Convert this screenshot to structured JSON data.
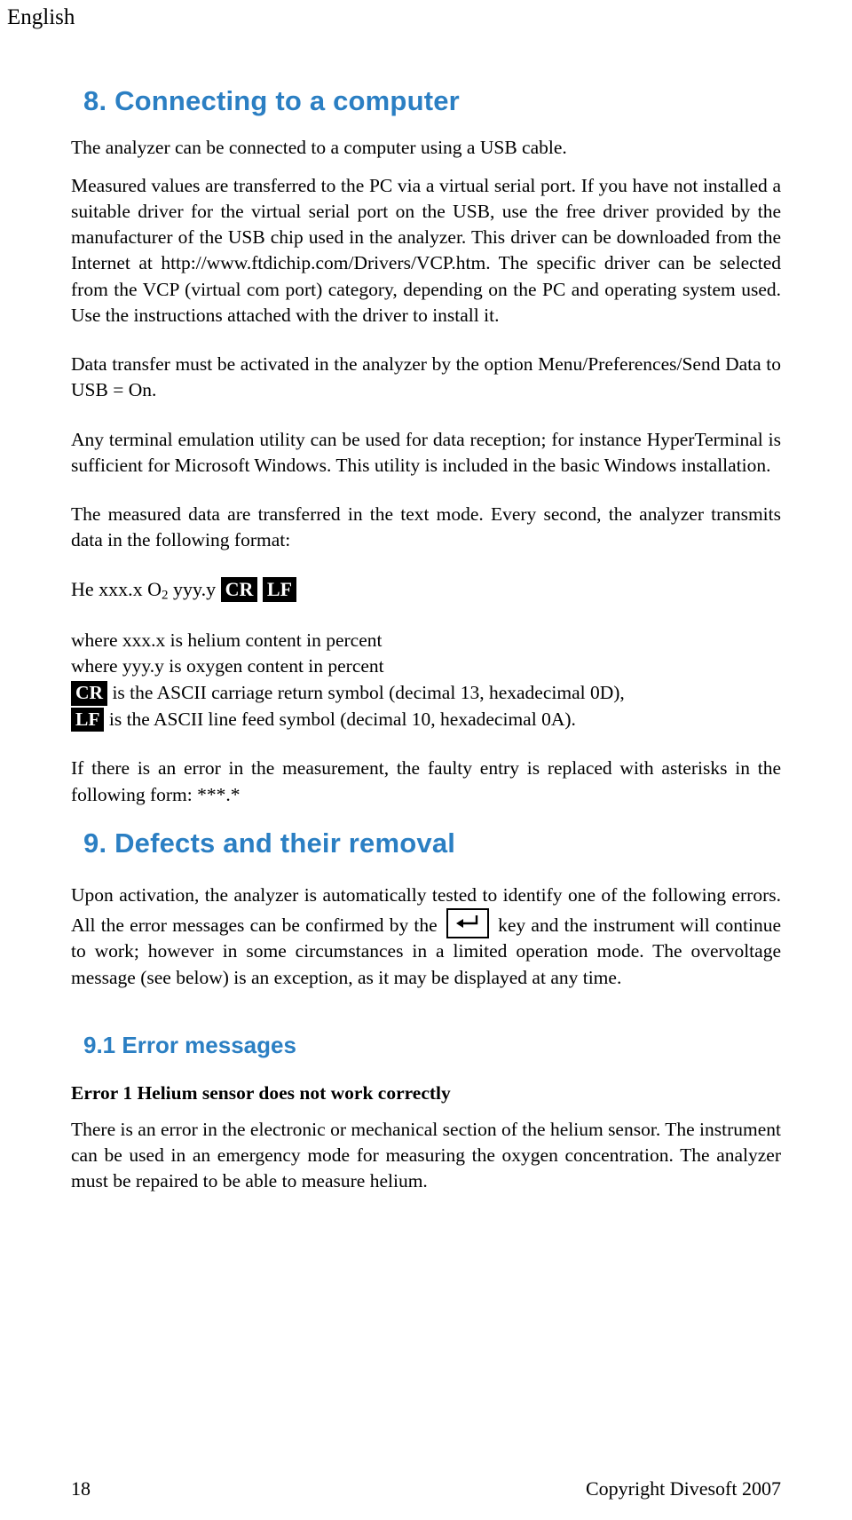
{
  "header": {
    "language": "English"
  },
  "sections": [
    {
      "number_title": "8. Connecting to a computer",
      "paragraphs": [
        "The analyzer can be connected to a computer using a USB cable.",
        "Measured values are transferred to the PC via a virtual serial port. If you have not installed a suitable driver for the virtual serial port on the USB, use the free driver provided by the manufacturer of the USB chip used in the analyzer. This driver can be downloaded from the Internet at http://www.ftdichip.com/Drivers/VCP.htm. The specific driver can be selected from the VCP (virtual com port) category, depending on the PC and operating system used. Use the instructions attached with the driver to install it.",
        "Data transfer must be activated in the analyzer by the option Menu/Preferences/Send Data to USB = On.",
        "Any terminal emulation utility can be used for data reception; for instance HyperTerminal is sufficient for Microsoft Windows. This utility is included in the basic Windows installation.",
        "The measured data are transferred in the text mode. Every second, the analyzer transmits data in the following format:"
      ]
    }
  ],
  "format_example": {
    "prefix": "He xxx.x O",
    "subscript": "2",
    "middle": " yyy.y ",
    "cr_label": "CR",
    "lf_label": "LF"
  },
  "legend": [
    {
      "text": "where xxx.x is helium content in percent"
    },
    {
      "text": "where yyy.y is oxygen content in percent"
    },
    {
      "badge": "CR",
      "text": " is the ASCII carriage return symbol (decimal 13, hexadecimal 0D),"
    },
    {
      "badge": "LF",
      "text": " is the ASCII line feed symbol (decimal 10, hexadecimal 0A)."
    }
  ],
  "error_note": "If there is an error in the measurement, the faulty entry is replaced with asterisks in the following form: ***.*",
  "defects": {
    "title": "9. Defects and their removal",
    "para_part1": "Upon activation, the analyzer is automatically tested to identify one of the following errors. All the error messages can be confirmed by the",
    "para_part2": "key and the instrument will continue to work; however in some circumstances in a limited operation mode. The overvoltage message (see below) is an exception, as it may be displayed at any time.",
    "subsection_title": "9.1 Error messages",
    "error1_heading": "Error 1 Helium sensor does not work correctly",
    "error1_body": "There is an error in the electronic or mechanical section of the helium sensor. The instrument can be used in an emergency mode for measuring the oxygen concentration. The analyzer must be repaired to be able to measure helium."
  },
  "footer": {
    "page_number": "18",
    "copyright": "Copyright Divesoft 2007"
  },
  "colors": {
    "heading": "#2b7fc3",
    "text": "#000000",
    "badge_bg": "#000000"
  }
}
